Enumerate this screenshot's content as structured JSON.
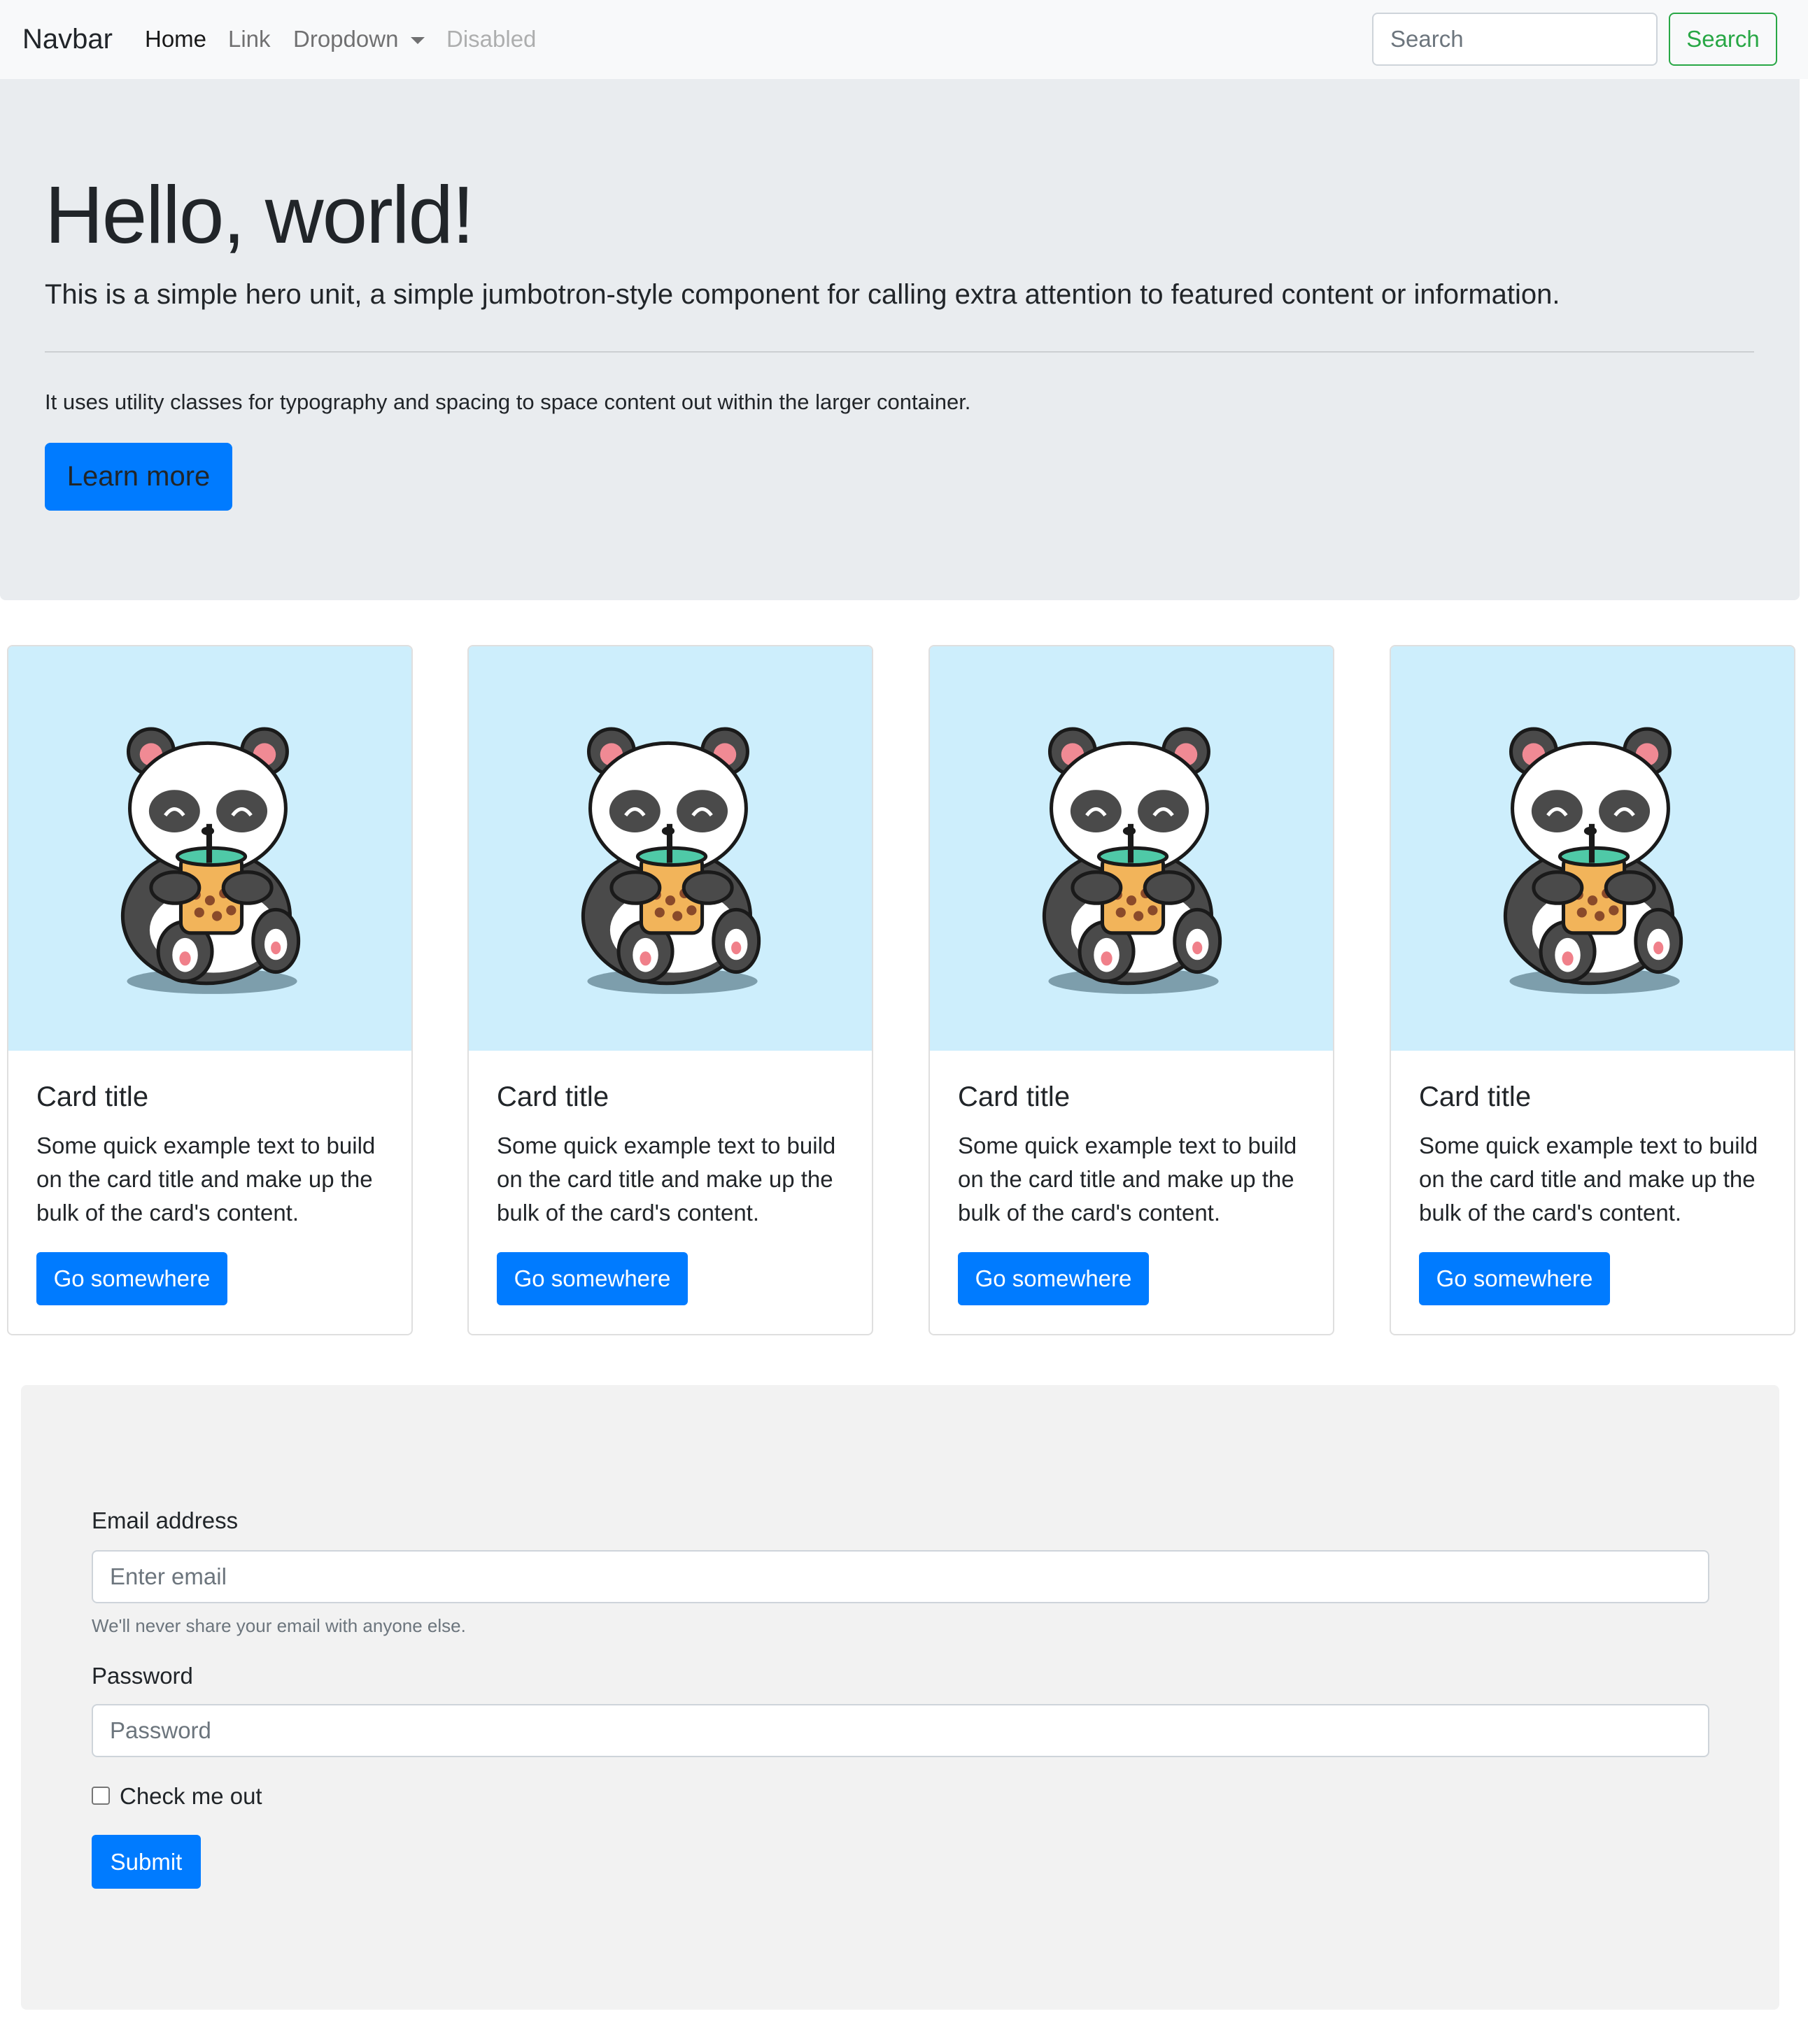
{
  "navbar": {
    "brand": "Navbar",
    "links": [
      "Home",
      "Link",
      "Dropdown",
      "Disabled"
    ],
    "search_placeholder": "Search",
    "search_button": "Search",
    "accent_color": "#28a745"
  },
  "hero": {
    "title": "Hello, world!",
    "lead": "This is a simple hero unit, a simple jumbotron-style component for calling extra attention to featured content or information.",
    "text": "It uses utility classes for typography and spacing to space content out within the larger container.",
    "button": "Learn more",
    "background": "#e9ecef"
  },
  "cards": [
    {
      "title": "Card title",
      "text": "Some quick example text to build on the card title and make up the bulk of the card's content.",
      "button": "Go somewhere",
      "image_icon": "panda-bubble-tea-illustration"
    },
    {
      "title": "Card title",
      "text": "Some quick example text to build on the card title and make up the bulk of the card's content.",
      "button": "Go somewhere",
      "image_icon": "panda-bubble-tea-illustration"
    },
    {
      "title": "Card title",
      "text": "Some quick example text to build on the card title and make up the bulk of the card's content.",
      "button": "Go somewhere",
      "image_icon": "panda-bubble-tea-illustration"
    },
    {
      "title": "Card title",
      "text": "Some quick example text to build on the card title and make up the bulk of the card's content.",
      "button": "Go somewhere",
      "image_icon": "panda-bubble-tea-illustration"
    }
  ],
  "form": {
    "email_label": "Email address",
    "email_placeholder": "Enter email",
    "email_help": "We'll never share your email with anyone else.",
    "password_label": "Password",
    "password_placeholder": "Password",
    "checkbox_label": "Check me out",
    "checkbox_checked": false,
    "submit": "Submit"
  },
  "colors": {
    "primary": "#007bff",
    "card_image_bg": "#cdeefc",
    "form_bg": "#f2f2f2"
  }
}
